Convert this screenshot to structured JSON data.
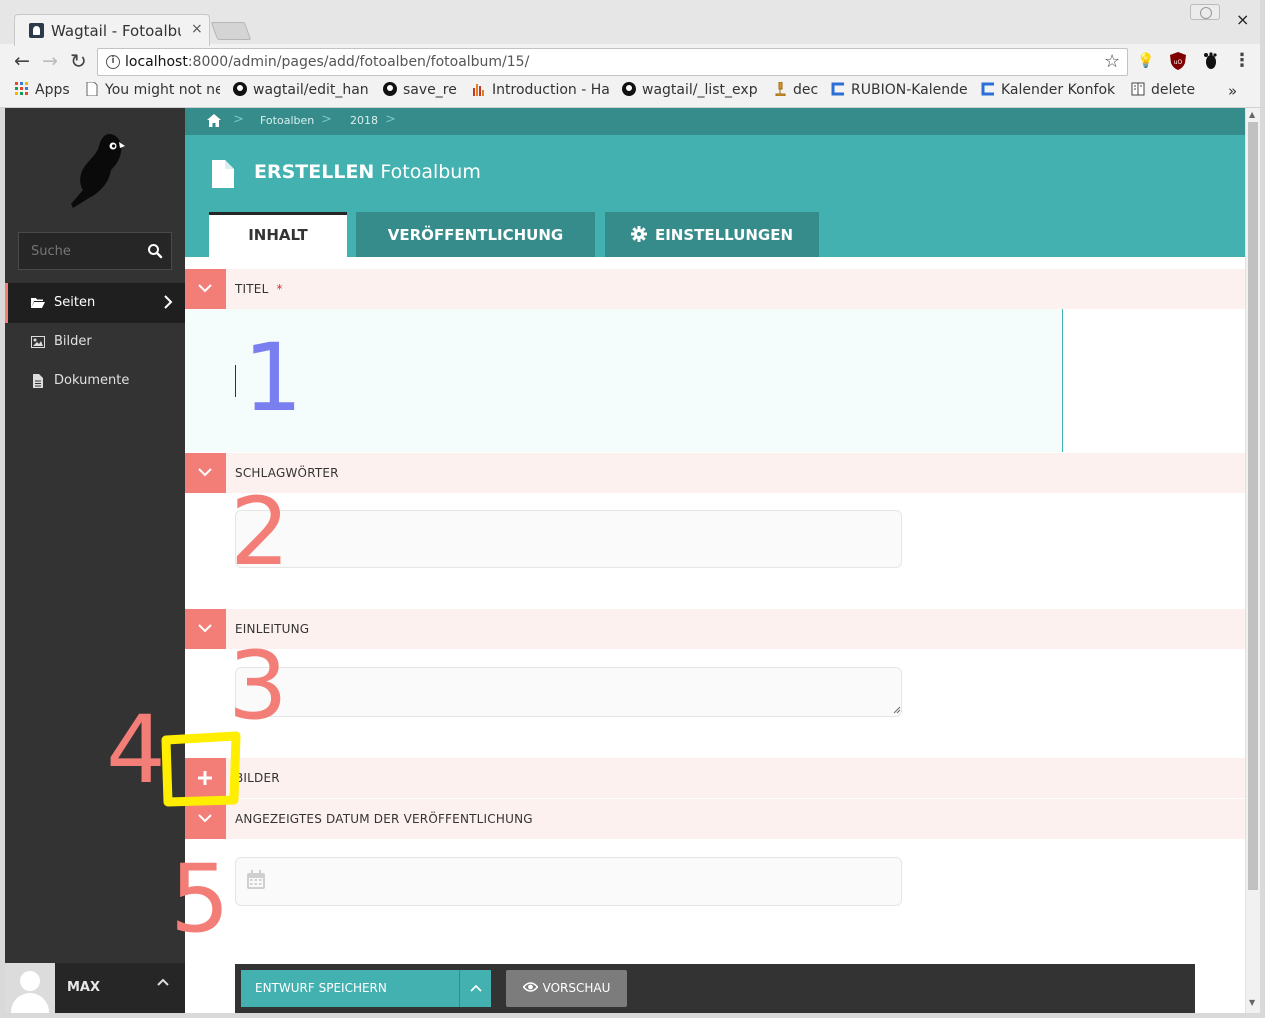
{
  "browser": {
    "tab_title": "Wagtail - Fotoalbum",
    "tab_close": "×",
    "window_close": "×",
    "url_host": "localhost",
    "url_rest": ":8000/admin/pages/add/fotoalben/fotoalbum/15/",
    "bookmarks": [
      {
        "label": "Apps",
        "icon": "apps-grid-icon"
      },
      {
        "label": "You might not ne",
        "icon": "page-icon"
      },
      {
        "label": "wagtail/edit_han",
        "icon": "github-icon"
      },
      {
        "label": "save_re",
        "icon": "github-icon"
      },
      {
        "label": "Introduction - Ha",
        "icon": "bar-chart-icon"
      },
      {
        "label": "wagtail/_list_exp",
        "icon": "github-icon"
      },
      {
        "label": "dec",
        "icon": "microscope-icon"
      },
      {
        "label": "RUBION-Kalende",
        "icon": "calendar-c-icon"
      },
      {
        "label": "Kalender Konfok",
        "icon": "calendar-c-icon"
      },
      {
        "label": "delete",
        "icon": "book-icon"
      }
    ],
    "bookmarks_more": "»"
  },
  "sidebar": {
    "search_placeholder": "Suche",
    "menu": [
      {
        "label": "Seiten",
        "icon": "folder-open-icon",
        "active": true
      },
      {
        "label": "Bilder",
        "icon": "image-icon",
        "active": false
      },
      {
        "label": "Dokumente",
        "icon": "document-icon",
        "active": false
      }
    ],
    "account_name": "MAX"
  },
  "breadcrumb": [
    "Fotoalben",
    "2018"
  ],
  "header": {
    "action": "ERSTELLEN",
    "model": "Fotoalbum"
  },
  "tabs": [
    {
      "label": "INHALT",
      "active": true
    },
    {
      "label": "VERÖFFENTLICHUNG",
      "active": false
    },
    {
      "label": "EINSTELLUNGEN",
      "active": false,
      "icon": "gear-icon"
    }
  ],
  "fields": {
    "title": {
      "label": "TITEL",
      "required_marker": "*",
      "value": ""
    },
    "tags": {
      "label": "SCHLAGWÖRTER",
      "value": ""
    },
    "intro": {
      "label": "EINLEITUNG",
      "value": ""
    },
    "images": {
      "label": "BILDER"
    },
    "date": {
      "label": "ANGEZEIGTES DATUM DER VERÖFFENTLICHUNG",
      "value": ""
    }
  },
  "annotations": {
    "n1": "1",
    "n2": "2",
    "n3": "3",
    "n4": "4",
    "n5": "5",
    "color_numbers": "#f37e77",
    "color_first": "#7a7ff0",
    "color_highlight": "#ffee00"
  },
  "footer": {
    "save_label": "ENTWURF SPEICHERN",
    "preview_label": "VORSCHAU"
  },
  "colors": {
    "teal": "#43b1b0",
    "teal_dark": "#358c8b",
    "salmon": "#f37e77",
    "sidebar": "#333333"
  }
}
